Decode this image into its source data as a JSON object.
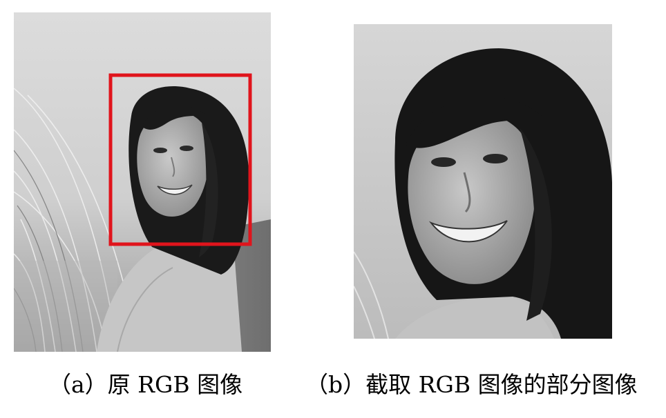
{
  "figure": {
    "panel_a": {
      "caption": "（a）原 RGB 图像",
      "crop_box_color": "#e0141c"
    },
    "panel_b": {
      "caption": "（b）截取 RGB 图像的部分图像"
    }
  },
  "colors": {
    "background": "#ffffff",
    "caption_text": "#000000",
    "crop_box": "#e0141c"
  }
}
